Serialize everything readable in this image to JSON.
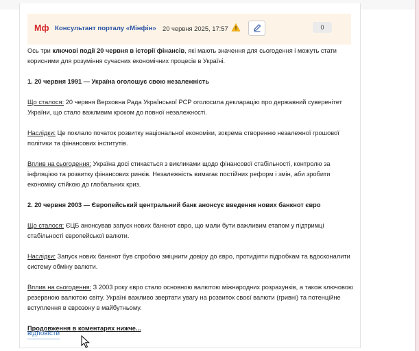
{
  "comment": {
    "logo": "Мф",
    "author": "Консультант порталу «Мінфін»",
    "date": "20 червня 2025, 17:57",
    "warning_icon": "warning-icon",
    "edit_icon": "pencil-icon",
    "count": "0",
    "intro": {
      "before": "Ось три ",
      "bold": "ключові події 20 червня в історії фінансів",
      "after": ", які мають значення для сьогодення і можуть стати корисними для розуміння сучасних економічних процесів в Україні."
    },
    "event1": {
      "heading": "1. 20 червня 1991 — Україна оголошує свою незалежність",
      "what_label": "Що сталося:",
      "what_text": " 20 червня Верховна Рада Української РСР оголосила декларацію про державний суверенітет України, що стало важливим кроком до повної незалежності.",
      "consequences_label": "Наслідки:",
      "consequences_text": " Це поклало початок розвитку національної економіки, зокрема створенню незалежної грошової політики та фінансових інститутів.",
      "impact_label": "Вплив на сьогодення:",
      "impact_text": " Україна досі стикається з викликами щодо фінансової стабільності, контролю за інфляцією та розвитку фінансових ринків. Незалежність вимагає постійних реформ і змін, аби зробити економіку стійкою до глобальних криз."
    },
    "event2": {
      "heading": "2. 20 червня 2003 — Європейський центральний банк анонсує введення нових банкнот євро",
      "what_label": "Що сталося:",
      "what_text": " ЄЦБ анонсував запуск нових банкнот євро, що мали бути важливим етапом у підтримці стабільності європейської валюти.",
      "consequences_label": "Наслідки:",
      "consequences_text": " Запуск нових банкнот був спробою зміцнити довіру до євро, протидіяти підробкам та вдосконалити систему обміну валюти.",
      "impact_label": "Вплив на сьогодення:",
      "impact_text": " З 2003 року євро стало основною валютою міжнародних розрахунків, а також ключовою резервною валютою світу. Україні важливо звертати увагу на розвиток своєї валюти (гривні) та потенційне вступлення в єврозону в майбутньому."
    },
    "more_link": "Продовження в коментарях нижче...",
    "reply": "відповісти"
  },
  "colors": {
    "header_bg": "#fdf4e7",
    "logo_red": "#d6282b",
    "author_blue": "#2a52a3",
    "link_blue": "#2a6ab8",
    "warning_yellow": "#f2b51d"
  }
}
